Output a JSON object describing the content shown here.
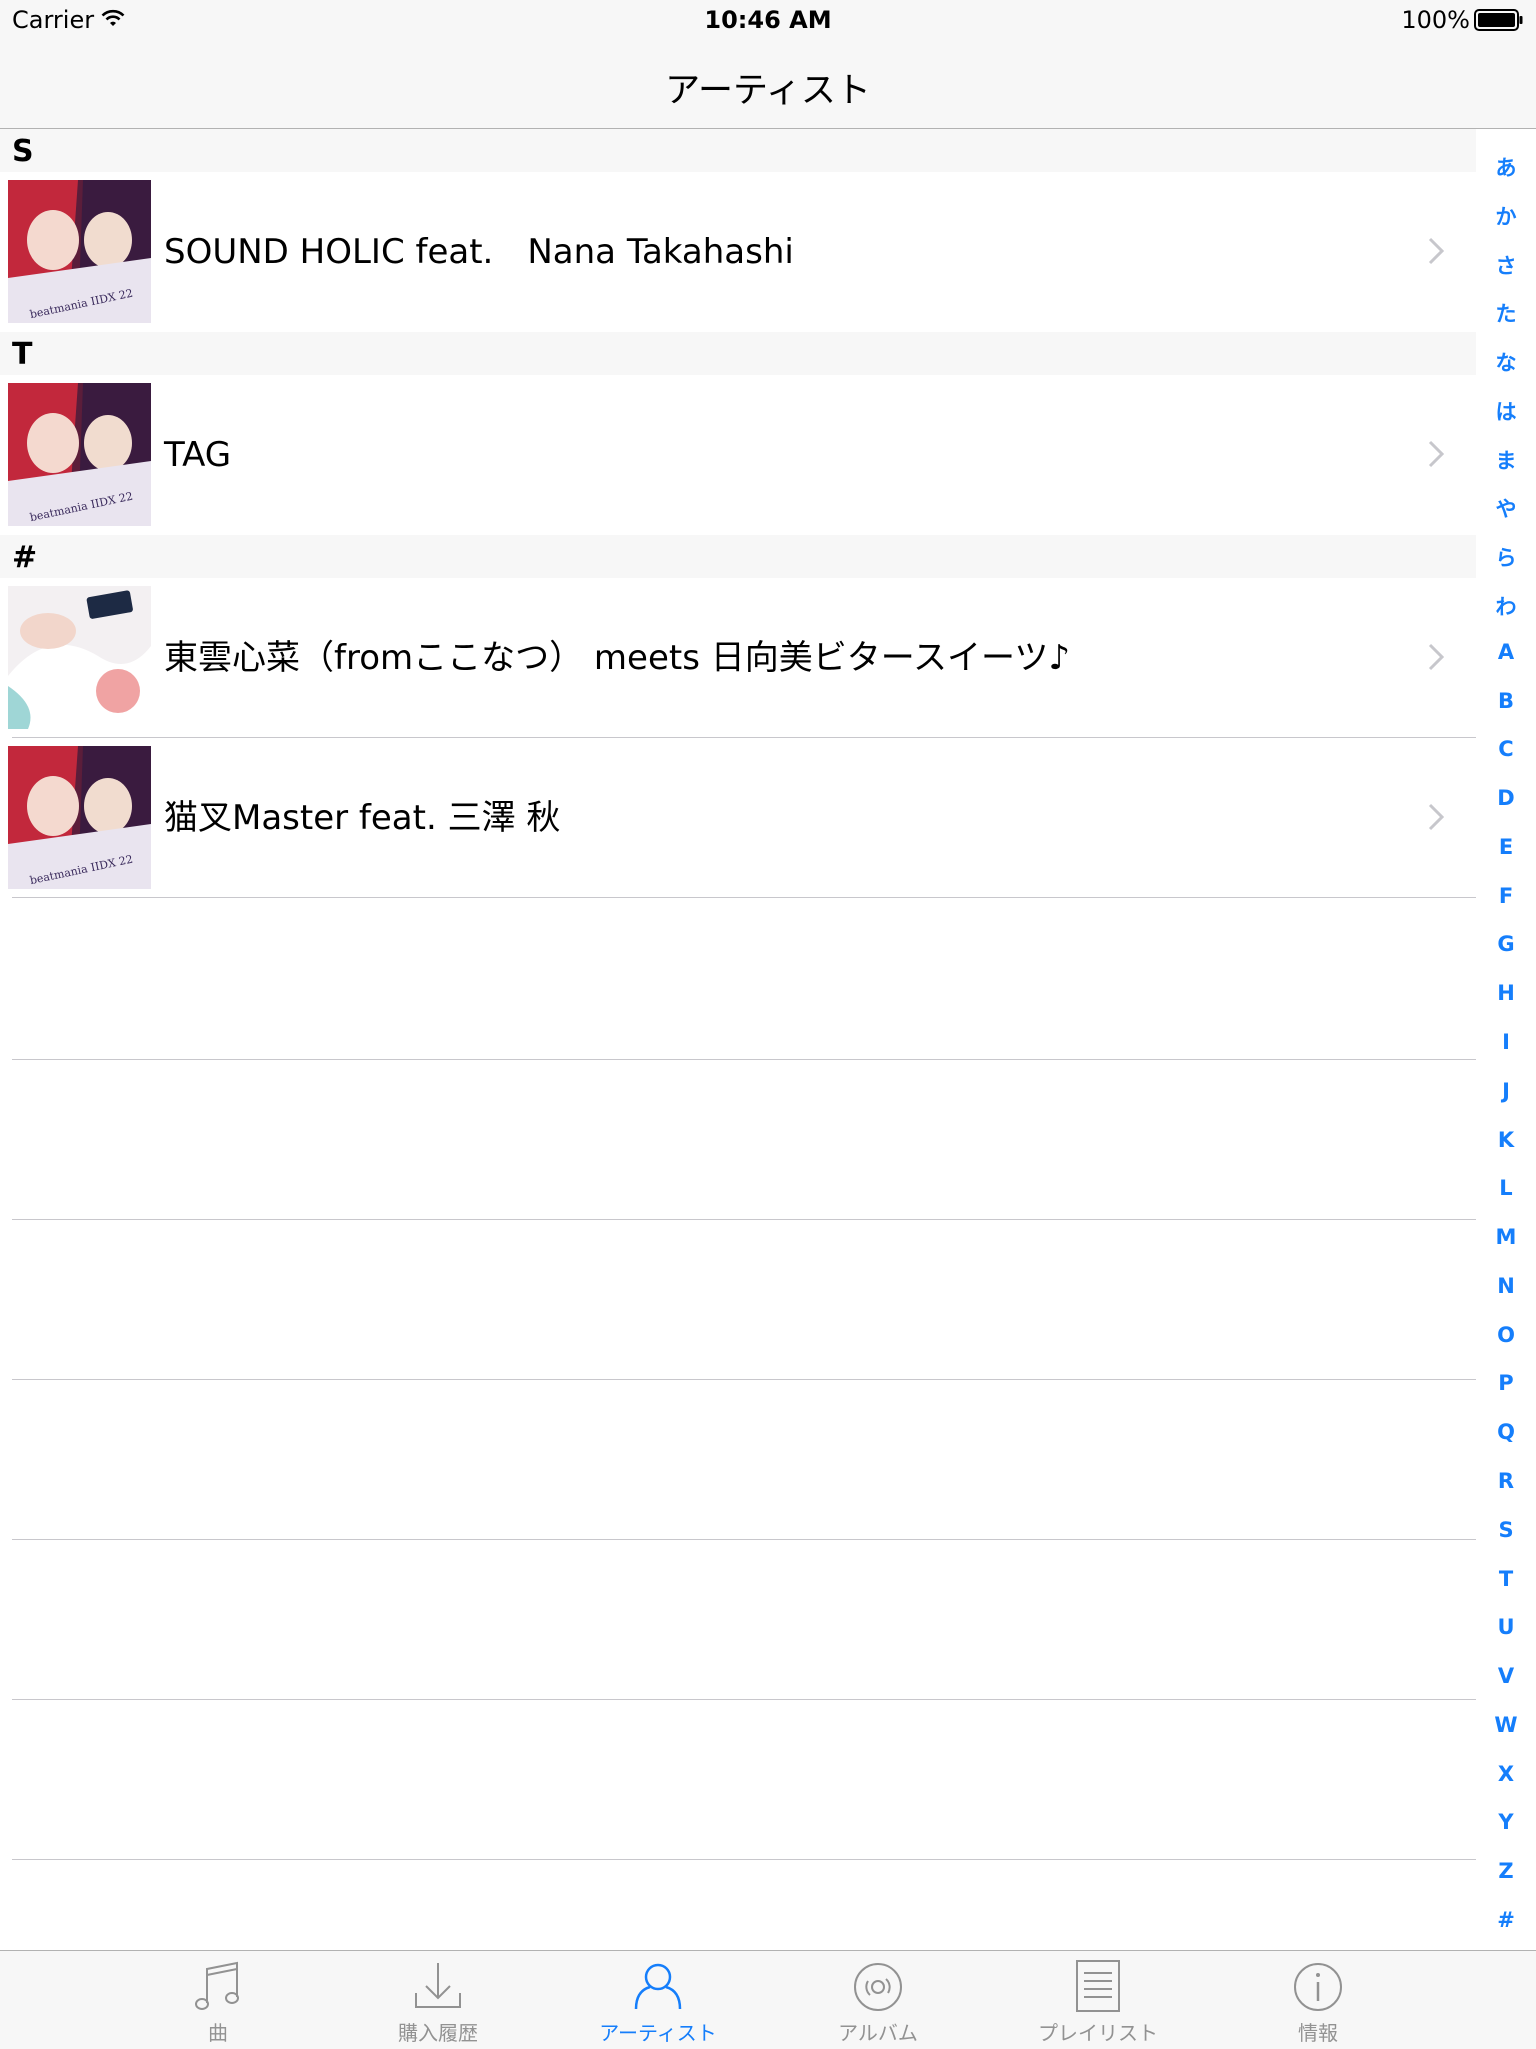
{
  "status_bar": {
    "carrier": "Carrier",
    "time": "10:46 AM",
    "battery": "100%"
  },
  "nav": {
    "title": "アーティスト"
  },
  "sections": [
    {
      "header": "S",
      "rows": [
        {
          "name": "SOUND HOLIC feat.　Nana Takahashi"
        }
      ]
    },
    {
      "header": "T",
      "rows": [
        {
          "name": "TAG"
        }
      ]
    },
    {
      "header": "#",
      "rows": [
        {
          "name": "東雲心菜（fromここなつ） meets 日向美ビタースイーツ♪"
        },
        {
          "name": "猫叉Master feat.  三澤 秋"
        }
      ]
    }
  ],
  "index": [
    "あ",
    "か",
    "さ",
    "た",
    "な",
    "は",
    "ま",
    "や",
    "ら",
    "わ",
    "A",
    "B",
    "C",
    "D",
    "E",
    "F",
    "G",
    "H",
    "I",
    "J",
    "K",
    "L",
    "M",
    "N",
    "O",
    "P",
    "Q",
    "R",
    "S",
    "T",
    "U",
    "V",
    "W",
    "X",
    "Y",
    "Z",
    "#"
  ],
  "tabs": [
    {
      "label": "曲",
      "icon": "music-note-icon"
    },
    {
      "label": "購入履歴",
      "icon": "download-icon"
    },
    {
      "label": "アーティスト",
      "icon": "artist-icon",
      "active": true
    },
    {
      "label": "アルバム",
      "icon": "album-disc-icon"
    },
    {
      "label": "プレイリスト",
      "icon": "playlist-icon"
    },
    {
      "label": "情報",
      "icon": "info-icon"
    }
  ],
  "colors": {
    "accent": "#157efb",
    "inactive": "#929292",
    "bar_bg": "#f7f7f7"
  }
}
